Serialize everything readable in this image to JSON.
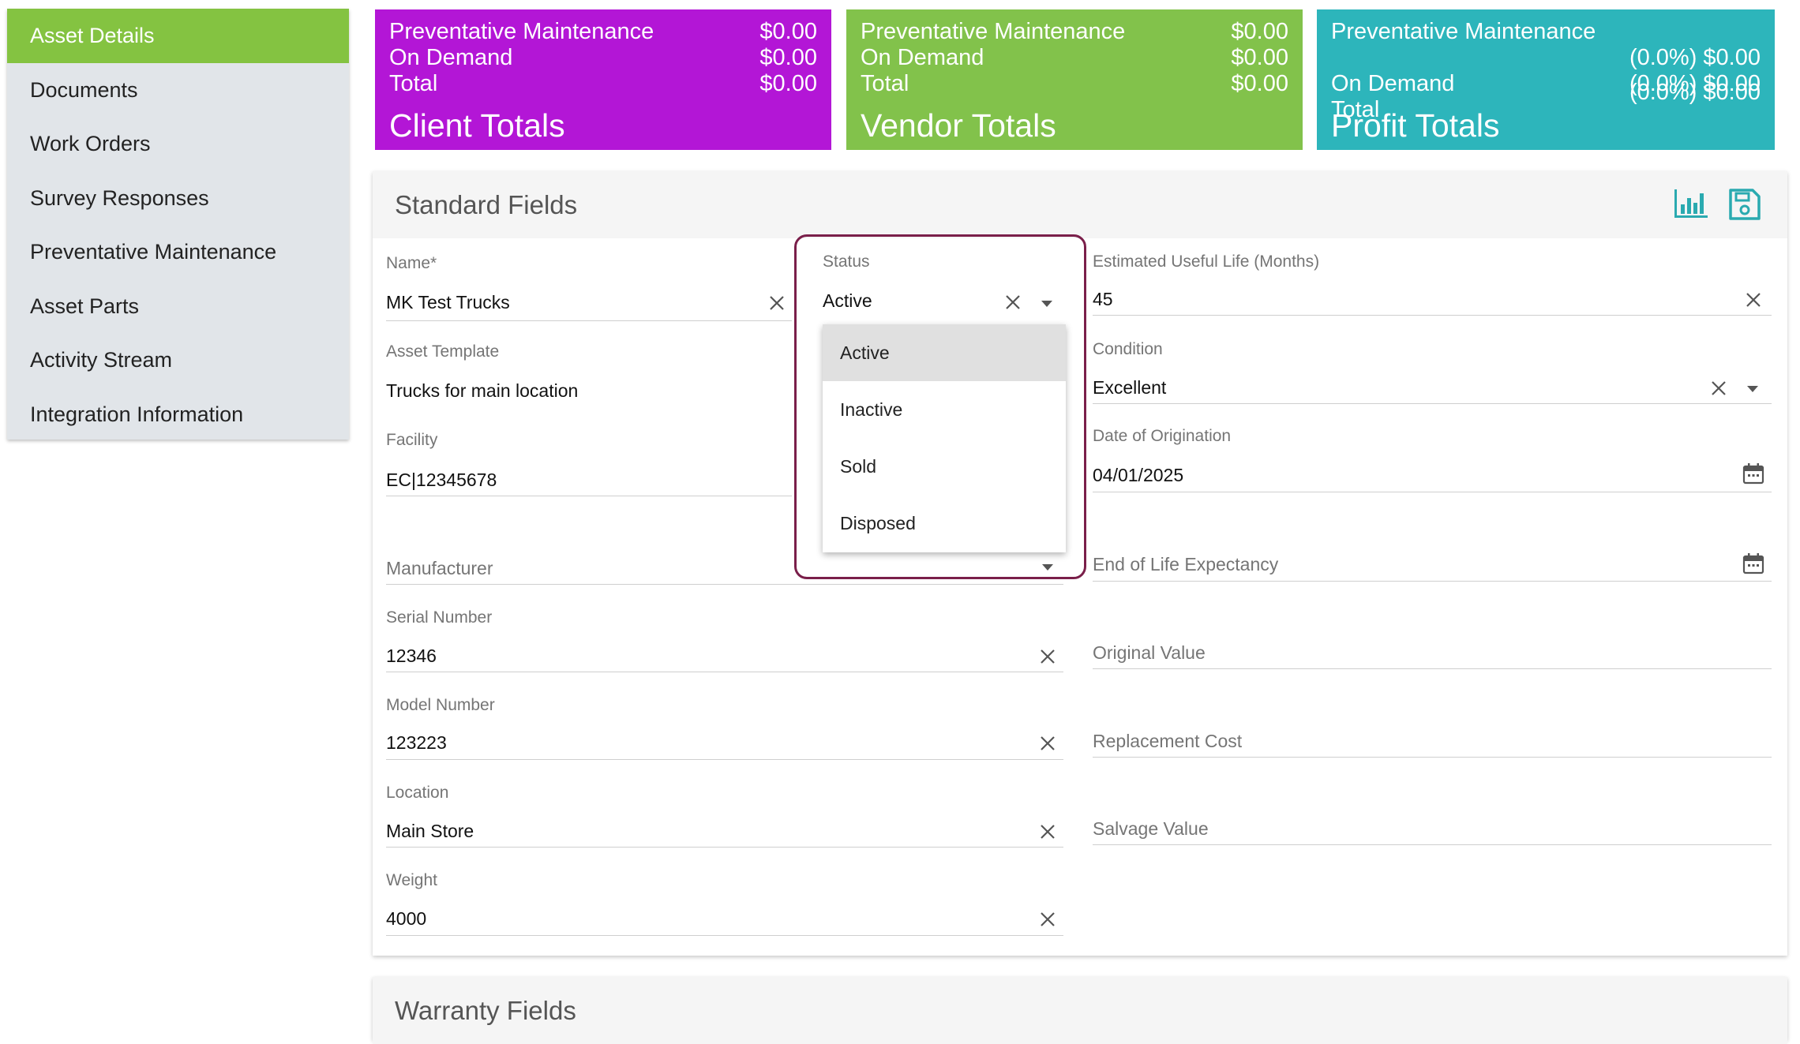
{
  "sidebar": {
    "items": [
      {
        "label": "Asset Details",
        "active": true
      },
      {
        "label": "Documents"
      },
      {
        "label": "Work Orders"
      },
      {
        "label": "Survey Responses"
      },
      {
        "label": "Preventative Maintenance"
      },
      {
        "label": "Asset Parts"
      },
      {
        "label": "Activity Stream"
      },
      {
        "label": "Integration Information"
      }
    ]
  },
  "cards": {
    "client": {
      "title": "Client Totals",
      "color": "#b316d6",
      "rows": [
        {
          "label": "Preventative Maintenance",
          "value": "$0.00"
        },
        {
          "label": "On Demand",
          "value": "$0.00"
        },
        {
          "label": "Total",
          "value": "$0.00"
        }
      ]
    },
    "vendor": {
      "title": "Vendor Totals",
      "color": "#82c24b",
      "rows": [
        {
          "label": "Preventative Maintenance",
          "value": "$0.00"
        },
        {
          "label": "On Demand",
          "value": "$0.00"
        },
        {
          "label": "Total",
          "value": "$0.00"
        }
      ]
    },
    "profit": {
      "title": "Profit Totals",
      "color": "#2db5bb",
      "rows": [
        {
          "label": "Preventative Maintenance",
          "value": "(0.0%) $0.00"
        },
        {
          "label": "On Demand",
          "value": "(0.0%) $0.00"
        },
        {
          "label": "Total",
          "value": "(0.0%) $0.00"
        }
      ]
    }
  },
  "standard": {
    "title": "Standard Fields",
    "icons": [
      "bar-chart-icon",
      "save-icon"
    ],
    "name": {
      "label": "Name*",
      "value": "MK Test Trucks"
    },
    "asset_template": {
      "label": "Asset Template",
      "value": "Trucks for main location"
    },
    "facility": {
      "label": "Facility",
      "value": "EC|12345678"
    },
    "manufacturer": {
      "placeholder": "Manufacturer"
    },
    "serial_number": {
      "label": "Serial Number",
      "value": "12346"
    },
    "model_number": {
      "label": "Model Number",
      "value": "123223"
    },
    "location": {
      "label": "Location",
      "value": "Main Store"
    },
    "weight": {
      "label": "Weight",
      "value": "4000"
    },
    "status": {
      "label": "Status",
      "value": "Active",
      "options": [
        "Active",
        "Inactive",
        "Sold",
        "Disposed"
      ]
    },
    "useful_life": {
      "label": "Estimated Useful Life (Months)",
      "value": "45"
    },
    "condition": {
      "label": "Condition",
      "value": "Excellent"
    },
    "date_origination": {
      "label": "Date of Origination",
      "value": "04/01/2025"
    },
    "end_of_life": {
      "placeholder": "End of Life Expectancy"
    },
    "original_value": {
      "placeholder": "Original Value"
    },
    "replacement_cost": {
      "placeholder": "Replacement Cost"
    },
    "salvage_value": {
      "placeholder": "Salvage Value"
    }
  },
  "warranty": {
    "title": "Warranty Fields"
  },
  "colors": {
    "active_nav": "#84c341",
    "sidebar_bg": "#e1e5e9",
    "icon_teal": "#2aaab0",
    "highlight_border": "#7a1f4a"
  }
}
